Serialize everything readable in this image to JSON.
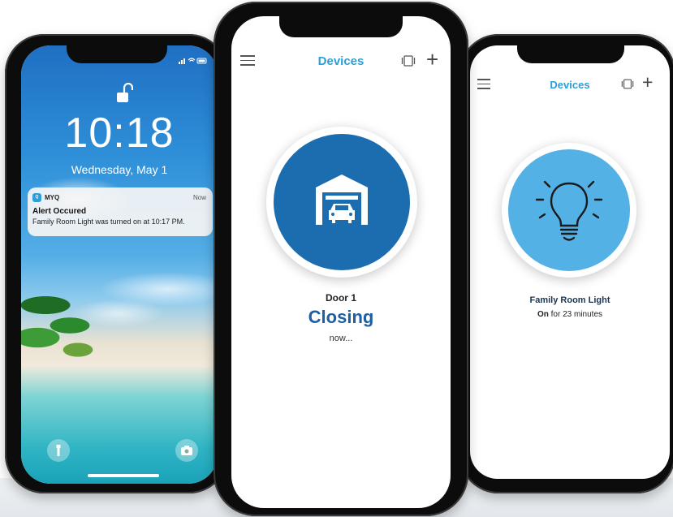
{
  "lock_screen": {
    "time": "10:18",
    "date": "Wednesday, May 1",
    "notification": {
      "app_name": "MYQ",
      "time": "Now",
      "title": "Alert Occured",
      "body": "Family Room Light was turned on at 10:17 PM."
    }
  },
  "garage_screen": {
    "header_title": "Devices",
    "device_name": "Door 1",
    "status": "Closing",
    "status_detail": "now..."
  },
  "light_screen": {
    "header_title": "Devices",
    "device_name": "Family Room Light",
    "status_state": "On",
    "status_detail": "for 23 minutes"
  },
  "colors": {
    "brand": "#2a9fd8",
    "garage_circle": "#1c6cb0",
    "light_circle": "#53b1e6",
    "status_text": "#1c5fa3"
  }
}
